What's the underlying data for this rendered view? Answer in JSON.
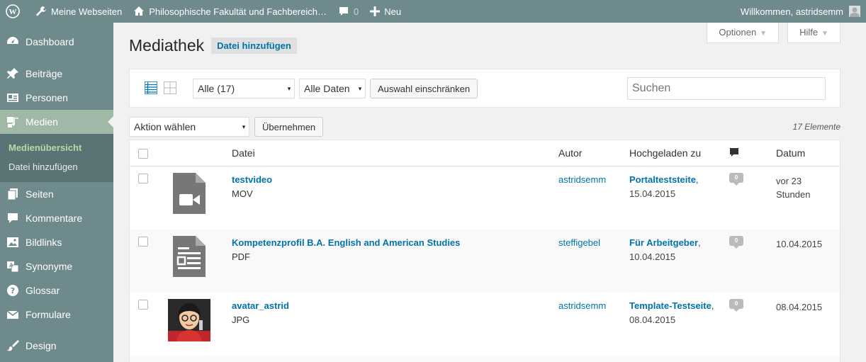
{
  "adminbar": {
    "my_sites": "Meine Webseiten",
    "site_name": "Philosophische Fakultät und Fachbereich…",
    "comments_count": "0",
    "new_label": "Neu",
    "welcome": "Willkommen, astridsemm"
  },
  "sidebar": {
    "items": [
      {
        "label": "Dashboard",
        "icon": "dashboard-icon"
      },
      {
        "label": "Beiträge",
        "icon": "pin-icon"
      },
      {
        "label": "Personen",
        "icon": "id-card-icon"
      },
      {
        "label": "Medien",
        "icon": "media-icon"
      },
      {
        "label": "Seiten",
        "icon": "pages-icon"
      },
      {
        "label": "Kommentare",
        "icon": "comment-icon"
      },
      {
        "label": "Bildlinks",
        "icon": "image-icon"
      },
      {
        "label": "Synonyme",
        "icon": "translate-icon"
      },
      {
        "label": "Glossar",
        "icon": "help-icon"
      },
      {
        "label": "Formulare",
        "icon": "mail-icon"
      },
      {
        "label": "Design",
        "icon": "brush-icon"
      }
    ],
    "submenu": [
      "Medienübersicht",
      "Datei hinzufügen"
    ]
  },
  "screen_options": "Optionen",
  "help": "Hilfe",
  "page_title": "Mediathek",
  "add_new": "Datei hinzufügen",
  "filters": {
    "type_select": "Alle (17)",
    "date_select": "Alle Daten",
    "filter_button": "Auswahl einschränken",
    "search_placeholder": "Suchen"
  },
  "bulk": {
    "action_select": "Aktion wählen",
    "apply_button": "Übernehmen",
    "count": "17 Elemente"
  },
  "table": {
    "headers": {
      "file": "Datei",
      "author": "Autor",
      "uploaded_to": "Hochgeladen zu",
      "date": "Datum"
    },
    "rows": [
      {
        "title": "testvideo",
        "type": "MOV",
        "author": "astridsemm",
        "parent": "Portalteststeite",
        "parent_date": "15.04.2015",
        "comments": "0",
        "date_line1": "vor 23",
        "date_line2": "Stunden",
        "thumb": "video-file-icon"
      },
      {
        "title": "Kompetenzprofil B.A. English and American Studies",
        "type": "PDF",
        "author": "steffigebel",
        "parent": "Für Arbeitgeber",
        "parent_date": "10.04.2015",
        "comments": "0",
        "date_line1": "10.04.2015",
        "date_line2": "",
        "thumb": "document-file-icon"
      },
      {
        "title": "avatar_astrid",
        "type": "JPG",
        "author": "astridsemm",
        "parent": "Template-Testseite",
        "parent_date": "08.04.2015",
        "comments": "0",
        "date_line1": "08.04.2015",
        "date_line2": "",
        "thumb": "avatar-image"
      }
    ]
  }
}
